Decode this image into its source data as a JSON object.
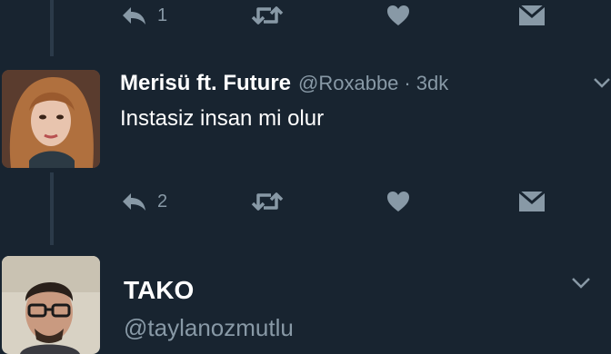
{
  "colors": {
    "background": "#182430",
    "icon": "#8899a6",
    "text": "#ffffff",
    "thread_line": "#2b3a49"
  },
  "icons": [
    "reply-icon",
    "retweet-icon",
    "like-icon",
    "direct-message-icon",
    "chevron-down-icon"
  ],
  "top_actions": {
    "reply_count": "1"
  },
  "tweets": [
    {
      "name": "Merisü ft. Future",
      "handle": "@Roxabbe",
      "separator": "·",
      "time": "3dk",
      "text": "Instasiz insan mi olur",
      "reply_count": "2"
    },
    {
      "name": "TAKO",
      "handle": "@taylanozmutlu"
    }
  ]
}
